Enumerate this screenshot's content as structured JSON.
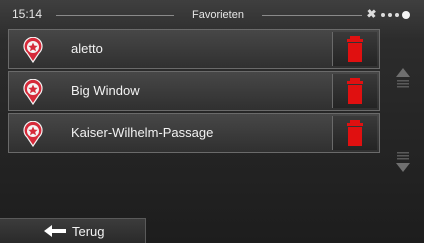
{
  "status": {
    "time": "15:14",
    "title": "Favorieten"
  },
  "favorites": [
    {
      "name": "aletto"
    },
    {
      "name": "Big Window"
    },
    {
      "name": "Kaiser-Wilhelm-Passage"
    }
  ],
  "back_label": "Terug",
  "icons": {
    "favorite": "favorite-pin-icon",
    "delete": "trash-icon",
    "scroll_up": "scroll-up-icon",
    "scroll_down": "scroll-down-icon",
    "back": "arrow-left-icon",
    "gps": "satellite-signal-icon"
  },
  "colors": {
    "delete": "#e01010",
    "pin": "#d62a3a"
  }
}
